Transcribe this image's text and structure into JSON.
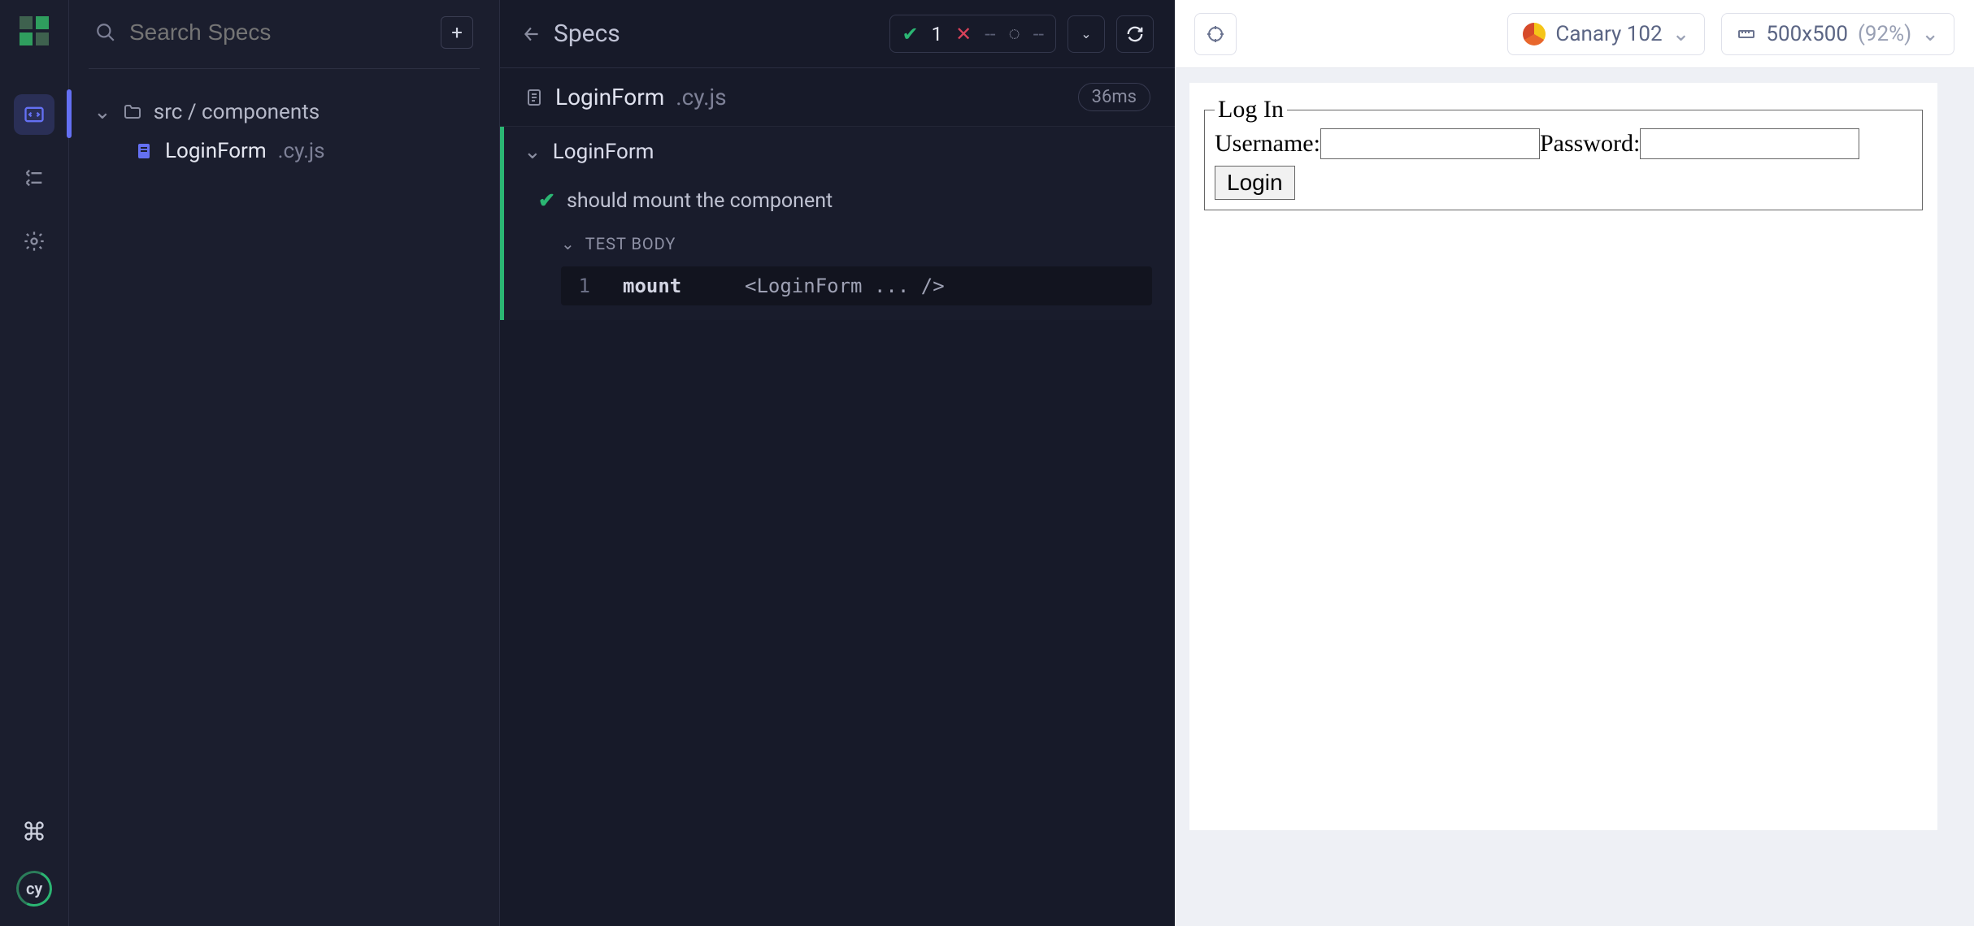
{
  "search": {
    "placeholder": "Search Specs"
  },
  "tree": {
    "folder": "src / components",
    "file": {
      "name": "LoginForm",
      "ext": ".cy.js"
    }
  },
  "reporter": {
    "title": "Specs",
    "stats": {
      "pass": "1",
      "fail": "--",
      "pending": "--"
    },
    "spec": {
      "name": "LoginForm",
      "ext": ".cy.js",
      "duration": "36ms"
    },
    "suite": "LoginForm",
    "test": "should mount the component",
    "bodyLabel": "TEST BODY",
    "cmd": {
      "idx": "1",
      "name": "mount",
      "arg": "<LoginForm ... />"
    }
  },
  "preview": {
    "browser": "Canary 102",
    "viewport": "500x500",
    "scale": "(92%)"
  },
  "aut": {
    "legend": "Log In",
    "usernameLabel": "Username:",
    "passwordLabel": "Password:",
    "button": "Login"
  }
}
